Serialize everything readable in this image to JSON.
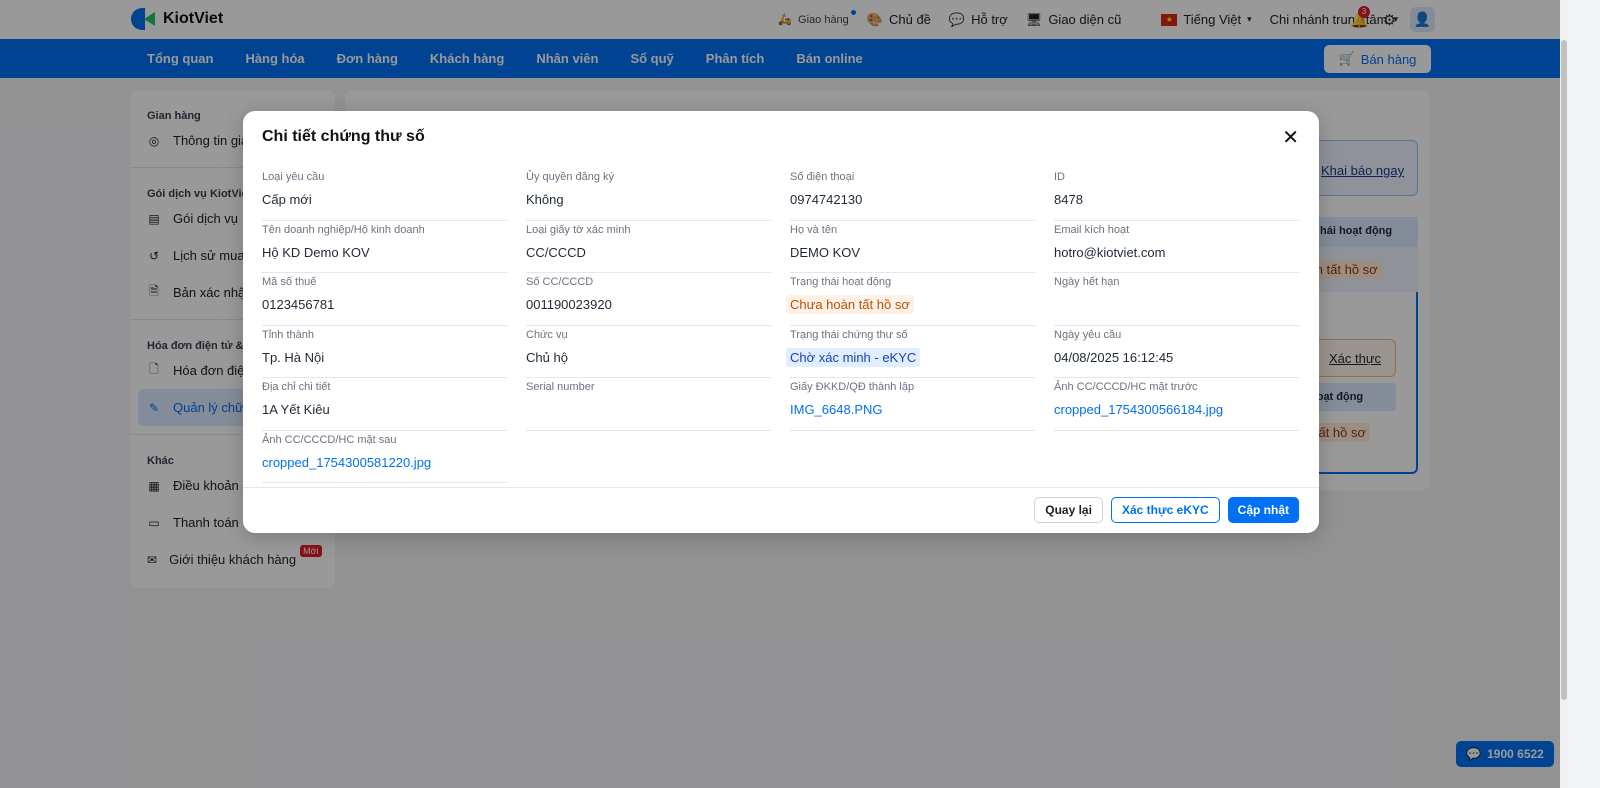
{
  "header": {
    "brand": "KiotViet",
    "items": [
      {
        "label": "Giao hàng",
        "icon": "delivery-icon"
      },
      {
        "label": "Chủ đề",
        "icon": "palette-icon"
      },
      {
        "label": "Hỗ trợ",
        "icon": "support-icon"
      },
      {
        "label": "Giao diện cũ",
        "icon": "monitor-icon"
      }
    ],
    "language": "Tiếng Việt",
    "branch": "Chi nhánh trung tâm",
    "notification_count": "3"
  },
  "nav": {
    "items": [
      "Tổng quan",
      "Hàng hóa",
      "Đơn hàng",
      "Khách hàng",
      "Nhân viên",
      "Sổ quỹ",
      "Phân tích",
      "Bán online"
    ],
    "sell_button": "Bán hàng"
  },
  "sidebar": {
    "sections": [
      {
        "title": "Gian hàng",
        "items": [
          "Thông tin gia"
        ]
      },
      {
        "title": "Gói dịch vụ KiotViet",
        "items": [
          "Gói dịch vụ",
          "Lịch sử mua",
          "Bản xác nhậ"
        ]
      },
      {
        "title": "Hóa đơn điện tử & C",
        "items": [
          "Hóa đơn điệ",
          "Quản lý chữ"
        ]
      },
      {
        "title": "Khác",
        "items": [
          "Điều khoản s",
          "Thanh toán",
          "Giới thiệu khách hàng"
        ]
      }
    ],
    "new_badge": "Mới"
  },
  "background": {
    "khai_bao": "Khai báo ngay",
    "col_header": "hái hoạt động",
    "status": "hoàn tất hồ sơ",
    "xac_thuc": "Xác thực",
    "col_header2": "hoạt động",
    "status2": "n tất hồ sơ"
  },
  "modal": {
    "title": "Chi tiết chứng thư số",
    "fields": [
      {
        "label": "Loại yêu cầu",
        "value": "Cấp mới"
      },
      {
        "label": "Ủy quyền đăng ký",
        "value": "Không"
      },
      {
        "label": "Số điện thoại",
        "value": "0974742130"
      },
      {
        "label": "ID",
        "value": "8478"
      },
      {
        "label": "Tên doanh nghiệp/Hộ kinh doanh",
        "value": "Hộ KD Demo KOV"
      },
      {
        "label": "Loại giấy tờ xác minh",
        "value": "CC/CCCD"
      },
      {
        "label": "Họ và tên",
        "value": "DEMO KOV"
      },
      {
        "label": "Email kích hoạt",
        "value": "hotro@kiotviet.com"
      },
      {
        "label": "Mã số thuế",
        "value": "0123456781"
      },
      {
        "label": "Số CC/CCCD",
        "value": "001190023920"
      },
      {
        "label": "Trạng thái hoạt động",
        "value": "Chưa hoàn tất hồ sơ",
        "type": "badge-orange"
      },
      {
        "label": "Ngày hết hạn",
        "value": ""
      },
      {
        "label": "Tỉnh thành",
        "value": "Tp. Hà Nội"
      },
      {
        "label": "Chức vụ",
        "value": "Chủ hộ"
      },
      {
        "label": "Trạng thái chứng thư số",
        "value": "Chờ xác minh - eKYC",
        "type": "badge-blue"
      },
      {
        "label": "Ngày yêu cầu",
        "value": "04/08/2025 16:12:45"
      },
      {
        "label": "Địa chỉ chi tiết",
        "value": "1A Yết Kiêu"
      },
      {
        "label": "Serial number",
        "value": ""
      },
      {
        "label": "Giấy ĐKKD/QĐ thành lập",
        "value": "IMG_6648.PNG",
        "type": "link"
      },
      {
        "label": "Ảnh CC/CCCD/HC mặt trước",
        "value": "cropped_1754300566184.jpg",
        "type": "link"
      },
      {
        "label": "Ảnh CC/CCCD/HC mặt sau",
        "value": "cropped_1754300581220.jpg",
        "type": "link"
      }
    ],
    "buttons": {
      "back": "Quay lại",
      "ekyc": "Xác thực eKYC",
      "update": "Cập nhật"
    }
  },
  "hotline": "1900 6522"
}
